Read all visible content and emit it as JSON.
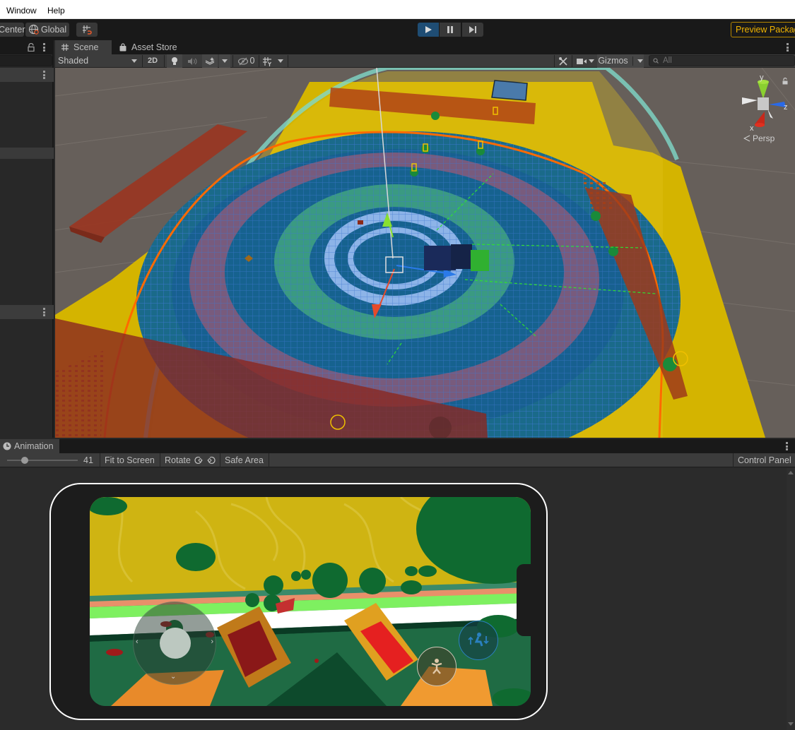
{
  "menu": {
    "items": [
      "Window",
      "Help"
    ]
  },
  "toolbar": {
    "pivot_label": "Center",
    "space_label": "Global",
    "play_active": true,
    "preview_packages_label": "Preview Packages"
  },
  "scene": {
    "tabs": [
      {
        "label": "Scene",
        "icon": "grid-icon",
        "active": true
      },
      {
        "label": "Asset Store",
        "icon": "shopping-bag-icon",
        "active": false
      }
    ],
    "draw_mode": "Shaded",
    "toggle_2d": "2D",
    "hidden_count": "0",
    "gizmos_label": "Gizmos",
    "search_placeholder": "All",
    "projection_label": "Persp",
    "axis_labels": {
      "x": "x",
      "y": "y",
      "z": "z"
    }
  },
  "game": {
    "tab_label": "Animation",
    "scale_value": "41",
    "scale_fraction": 0.25,
    "fit_to_screen": "Fit to Screen",
    "rotate_label": "Rotate",
    "safe_area": "Safe Area",
    "control_panel": "Control Panel"
  },
  "colors": {
    "play_active": "#1f4d74",
    "preview_accent": "#f0b400",
    "scene_bg": "#665f5a",
    "yellow_floor": "#d4b400",
    "orange_outline": "#ff6a00"
  }
}
